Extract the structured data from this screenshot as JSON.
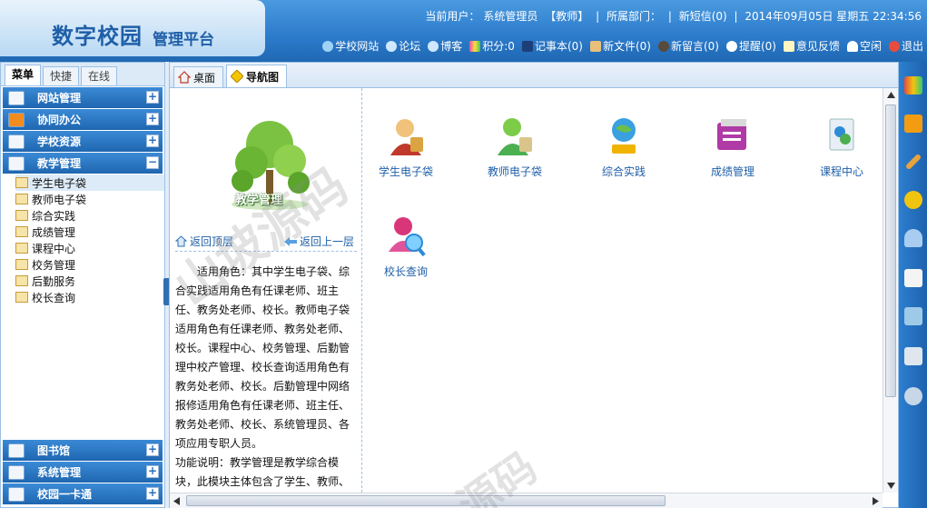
{
  "header": {
    "title": "数字校园",
    "subtitle": "管理平台",
    "status": {
      "current_user_label": "当前用户：",
      "current_user": "系统管理员",
      "role": "【教师】",
      "dept_label": "所属部门：",
      "new_sms": "新短信(0)",
      "datetime": "2014年09月05日 星期五 22:34:56"
    },
    "toolbar": [
      {
        "label": "学校网站",
        "icon": "globe-icon"
      },
      {
        "label": "论坛",
        "icon": "forum-icon"
      },
      {
        "label": "博客",
        "icon": "blog-icon"
      },
      {
        "label": "积分:0",
        "icon": "points-icon"
      },
      {
        "label": "记事本(0)",
        "icon": "notebook-icon"
      },
      {
        "label": "新文件(0)",
        "icon": "file-icon"
      },
      {
        "label": "新留言(0)",
        "icon": "message-icon"
      },
      {
        "label": "提醒(0)",
        "icon": "reminder-icon"
      },
      {
        "label": "意见反馈",
        "icon": "feedback-icon"
      },
      {
        "label": "空闲",
        "icon": "user-status-icon"
      },
      {
        "label": "退出",
        "icon": "logout-icon"
      }
    ]
  },
  "left_panel": {
    "tabs": [
      "菜单",
      "快捷",
      "在线"
    ],
    "menus_top": [
      {
        "label": "网站管理",
        "btn": "+"
      },
      {
        "label": "协同办公",
        "btn": "+"
      },
      {
        "label": "学校资源",
        "btn": "+"
      },
      {
        "label": "教学管理",
        "btn": "−"
      }
    ],
    "submenu": [
      "学生电子袋",
      "教师电子袋",
      "综合实践",
      "成绩管理",
      "课程中心",
      "校务管理",
      "后勤服务",
      "校长查询"
    ],
    "menus_bottom": [
      {
        "label": "图书馆",
        "btn": "+"
      },
      {
        "label": "系统管理",
        "btn": "+"
      },
      {
        "label": "校园一卡通",
        "btn": "+"
      }
    ]
  },
  "main": {
    "tabs": [
      {
        "label": "桌面",
        "icon": "home-icon"
      },
      {
        "label": "导航图",
        "icon": "nav-map-icon"
      }
    ],
    "module_title": "教学管理",
    "back_top": "返回顶层",
    "back_up": "返回上一层",
    "description": [
      "适用角色：其中学生电子袋、综合实践适用角色有任课老师、班主任、教务处老师、校长。教师电子袋适用角色有任课老师、教务处老师、校长。课程中心、校务管理、后勤管理中校产管理、校长查询适用角色有教务处老师、校长。后勤管理中网络报修适用角色有任课老师、班主任、教务处老师、校长、系统管理员、各项应用专职人员。",
      "功能说明：教学管理是教学综合模块，此模块主体包含了学生、教师、"
    ],
    "apps": [
      {
        "label": "学生电子袋",
        "icon": "student-bag-icon",
        "color": "#c0392b"
      },
      {
        "label": "教师电子袋",
        "icon": "teacher-bag-icon",
        "color": "#4caf50"
      },
      {
        "label": "综合实践",
        "icon": "practice-icon",
        "color": "#f0b400"
      },
      {
        "label": "成绩管理",
        "icon": "grades-icon",
        "color": "#b03aa6"
      },
      {
        "label": "课程中心",
        "icon": "course-icon",
        "color": "#2e8bd6"
      },
      {
        "label": "校长查询",
        "icon": "principal-query-icon",
        "color": "#d9367a"
      }
    ]
  },
  "watermark": [
    "山坡源码",
    "源码"
  ]
}
